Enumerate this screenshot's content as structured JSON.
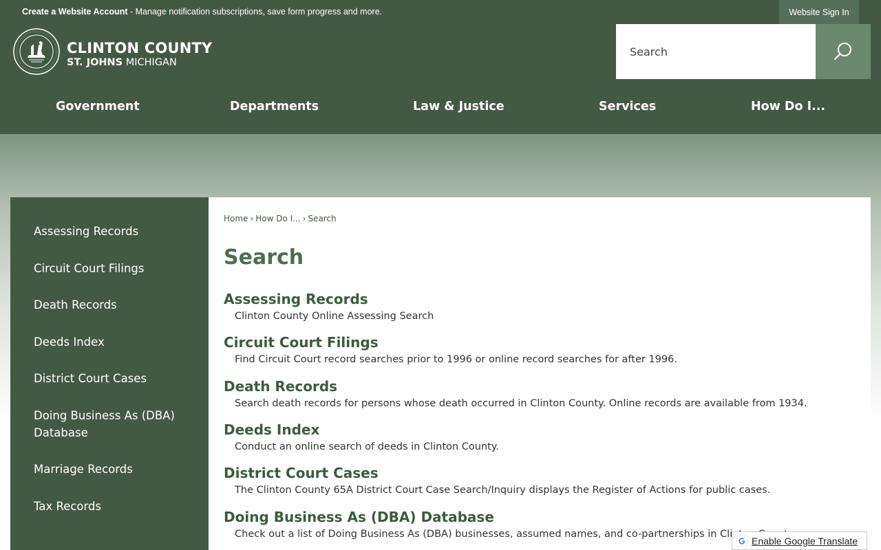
{
  "topbar": {
    "account_link": "Create a Website Account",
    "account_desc": " - Manage notification subscriptions, save form progress and more.",
    "signin": "Website Sign In"
  },
  "header": {
    "logo_name": "CLINTON COUNTY",
    "logo_sub_bold": "ST. JOHNS",
    "logo_sub": " MICHIGAN",
    "search_placeholder": "Search",
    "nav": [
      "Government",
      "Departments",
      "Law & Justice",
      "Services",
      "How Do I..."
    ]
  },
  "sidebar": {
    "items": [
      "Assessing Records",
      "Circuit Court Filings",
      "Death Records",
      "Deeds Index",
      "District Court Cases",
      "Doing Business As (DBA) Database",
      "Marriage Records",
      "Tax Records"
    ]
  },
  "breadcrumb": [
    "Home",
    "How Do I...",
    "Search"
  ],
  "page_title": "Search",
  "results": [
    {
      "title": "Assessing Records",
      "desc": "Clinton County Online Assessing Search"
    },
    {
      "title": "Circuit Court Filings",
      "desc": "Find Circuit Court record searches prior to 1996 or online record searches for after 1996."
    },
    {
      "title": "Death Records",
      "desc": "Search death records for persons whose death occurred in Clinton County. Online records are available from 1934."
    },
    {
      "title": "Deeds Index",
      "desc": "Conduct an online search of deeds in Clinton County."
    },
    {
      "title": "District Court Cases",
      "desc": "The Clinton County 65A District Court Case Search/Inquiry displays the Register of Actions for public cases."
    },
    {
      "title": "Doing Business As (DBA) Database",
      "desc": "Check out a list of Doing Business As (DBA) businesses, assumed names, and co-partnerships in Clinton County."
    }
  ],
  "translate": {
    "label": "Enable Google Translate"
  },
  "colors": {
    "primary": "#425a43",
    "accent": "#6b8a6d",
    "title": "#4f6d52"
  }
}
